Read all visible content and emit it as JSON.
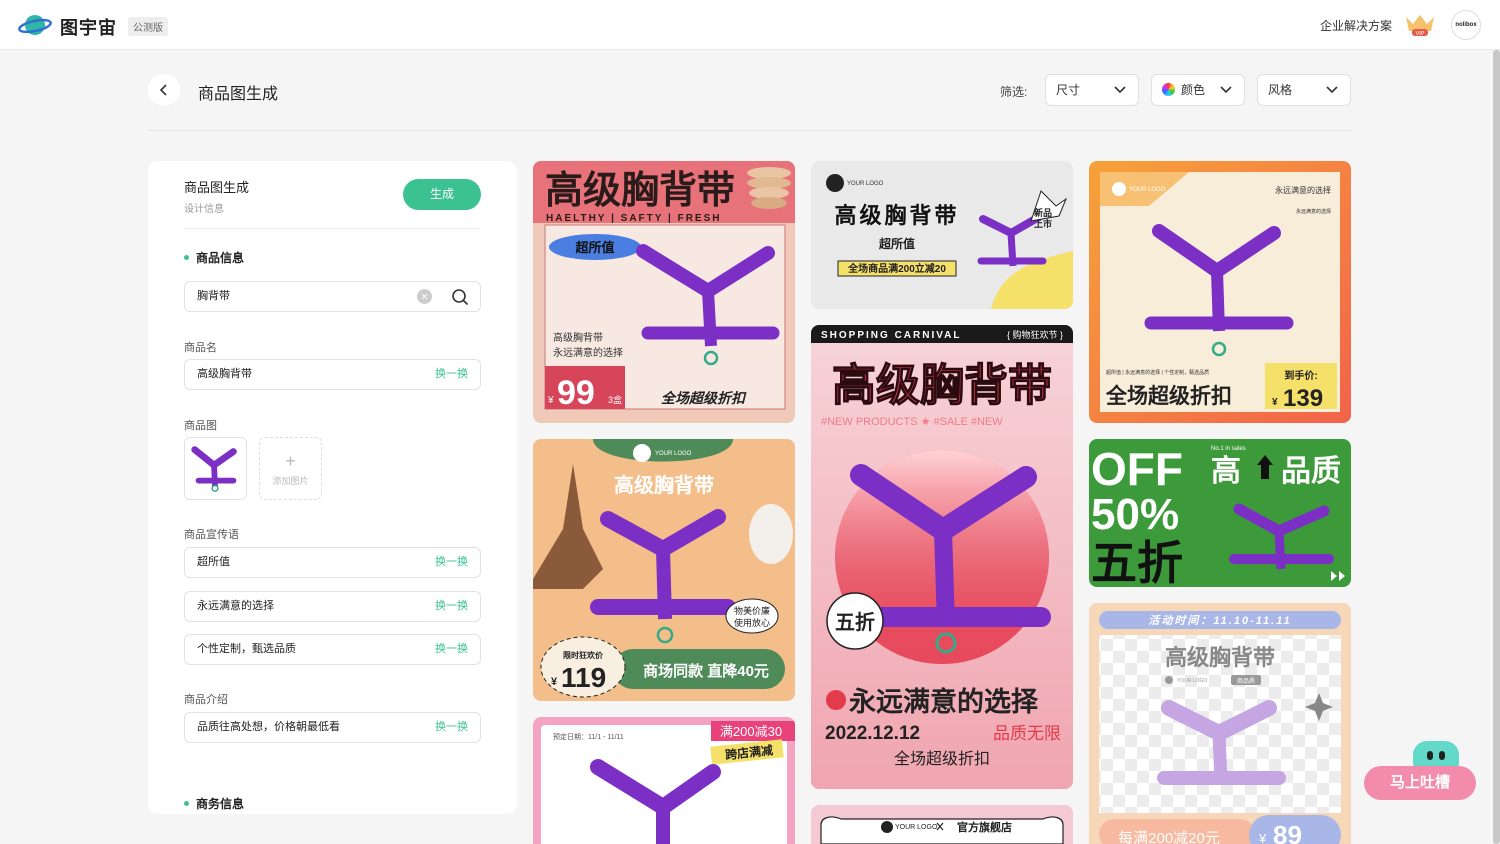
{
  "app": {
    "name": "图宇宙",
    "badge": "公测版",
    "enterprise": "企业解决方案",
    "vip": "VIP",
    "avatar": "nolibox"
  },
  "page": {
    "title": "商品图生成",
    "filter_label": "筛选:",
    "filters": [
      {
        "label": "尺寸"
      },
      {
        "label": "颜色"
      },
      {
        "label": "风格"
      }
    ]
  },
  "panel": {
    "title": "商品图生成",
    "subtitle": "设计信息",
    "generate": "生成",
    "section_product": "商品信息",
    "search_value": "胸背带",
    "name_label": "商品名",
    "name_value": "高级胸背带",
    "swap": "换一换",
    "image_label": "商品图",
    "add_image": "添加图片",
    "slogan_label": "商品宣传语",
    "slogans": [
      "超所值",
      "永远满意的选择",
      "个性定制，甄选品质"
    ],
    "intro_label": "商品介绍",
    "intro_value": "品质往高处想，价格朝最低看",
    "section_business": "商务信息"
  },
  "cards": {
    "c1": {
      "title": "高级胸背带",
      "tagline": "HAELTHY | SAFTY | FRESH",
      "badge": "超所值",
      "line1": "高级胸背带",
      "line2": "永远满意的选择",
      "price_currency": "¥",
      "price": "99",
      "unit": "3盒",
      "cta": "全场超级折扣"
    },
    "c2": {
      "logo": "YOUR LOGO",
      "title": "高级胸背带",
      "sub": "超所值",
      "promo": "全场商品满200立减20",
      "new1": "新品",
      "new2": "上市"
    },
    "c3": {
      "logo": "YOUR LOGO",
      "tag1": "永远满意的选择",
      "tag2": "永远满意的选择",
      "small": "超所值 | 永远满意的选择 | 个性定制，甄选品质",
      "cta": "全场超级折扣",
      "price_label": "到手价:",
      "currency": "¥",
      "price": "139"
    },
    "c4": {
      "header": "SHOPPING CARNIVAL",
      "header_r": "{ 购物狂欢节 }",
      "title": "高级胸背带",
      "tags": "#NEW PRODUCTS ★ #SALE   #NEW",
      "burst": "五折",
      "line": "永远满意的选择",
      "date": "2022.12.12",
      "quality": "品质无限",
      "cta": "全场超级折扣"
    },
    "c5": {
      "logo": "YOUR LOGO",
      "title": "高级胸背带",
      "bubble1": "物美价廉",
      "bubble2": "使用放心",
      "price_label": "限时狂欢价",
      "currency": "¥",
      "price": "119",
      "cta": "商场同款 直降40元"
    },
    "c6": {
      "off": "OFF",
      "pct": "50%",
      "five": "五折",
      "no1": "No.1 in sales",
      "title": "高",
      "title2": "品质"
    },
    "c7": {
      "date": "预定日期：11/1 - 11/11",
      "promo1": "满200减30",
      "promo2": "跨店满减"
    },
    "c8": {
      "logo": "YOUR LOGO",
      "store": "官方旗舰店"
    },
    "c9": {
      "banner": "活动时间：11.10-11.11",
      "title": "高级胸背带",
      "logo": "YOUR LOGO",
      "newtag": "商品质",
      "promo": "每满200减20元",
      "currency": "¥",
      "price": "89"
    }
  },
  "feedback": {
    "label": "马上吐槽"
  }
}
